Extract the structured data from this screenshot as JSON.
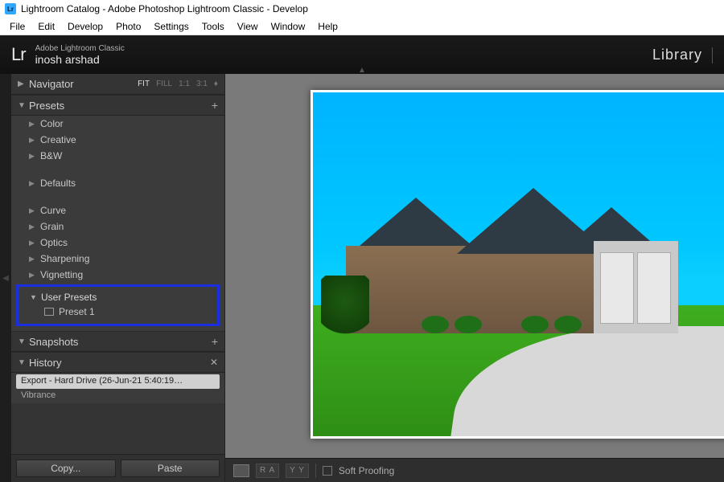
{
  "titlebar": {
    "icon_text": "Lr",
    "title": "Lightroom Catalog - Adobe Photoshop Lightroom Classic - Develop"
  },
  "menubar": [
    "File",
    "Edit",
    "Develop",
    "Photo",
    "Settings",
    "Tools",
    "View",
    "Window",
    "Help"
  ],
  "brand": {
    "logo": "Lr",
    "product": "Adobe Lightroom Classic",
    "user": "inosh arshad",
    "module": "Library"
  },
  "navigator": {
    "title": "Navigator",
    "zoom": {
      "fit": "FIT",
      "fill": "FILL",
      "one": "1:1",
      "three": "3:1"
    }
  },
  "presets": {
    "title": "Presets",
    "groups_top": [
      "Color",
      "Creative",
      "B&W"
    ],
    "groups_mid": [
      "Defaults"
    ],
    "groups_bot": [
      "Curve",
      "Grain",
      "Optics",
      "Sharpening",
      "Vignetting"
    ],
    "user_header": "User Presets",
    "user_items": [
      "Preset 1"
    ]
  },
  "snapshots": {
    "title": "Snapshots"
  },
  "history": {
    "title": "History",
    "items": [
      "Export - Hard Drive (26-Jun-21 5:40:19…",
      "Vibrance"
    ]
  },
  "footer": {
    "copy": "Copy...",
    "paste": "Paste"
  },
  "toolbar": {
    "compare_a": "R A",
    "compare_b": "Y Y",
    "softproof": "Soft Proofing"
  }
}
